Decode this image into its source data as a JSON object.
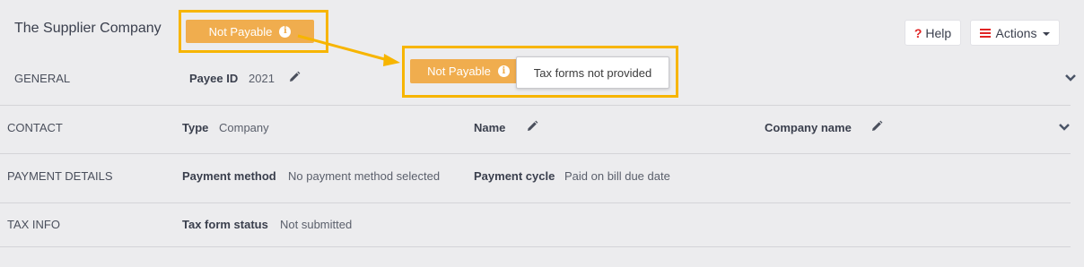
{
  "header": {
    "company_name": "The Supplier Company",
    "status_badge": "Not Payable",
    "help_label": "Help",
    "help_icon": "?",
    "actions_label": "Actions"
  },
  "callout": {
    "badge_label": "Not Payable",
    "tooltip_text": "Tax forms not provided",
    "highlight_color": "#f7b500"
  },
  "sections": {
    "general": {
      "label": "GENERAL",
      "payee_id_label": "Payee ID",
      "payee_id_value": "2021"
    },
    "contact": {
      "label": "CONTACT",
      "type_label": "Type",
      "type_value": "Company",
      "name_label": "Name",
      "company_name_label": "Company name"
    },
    "payment_details": {
      "label": "PAYMENT DETAILS",
      "method_label": "Payment method",
      "method_value": "No payment method selected",
      "cycle_label": "Payment cycle",
      "cycle_value": "Paid on bill due date"
    },
    "tax_info": {
      "label": "TAX INFO",
      "status_label": "Tax form status",
      "status_value": "Not submitted"
    }
  },
  "colors": {
    "badge": "#f0ad4e",
    "accent_red": "#e02424",
    "background": "#ececee"
  },
  "icons": [
    "info-icon",
    "pencil-icon",
    "chevron-down-icon",
    "hamburger-icon",
    "question-icon"
  ]
}
